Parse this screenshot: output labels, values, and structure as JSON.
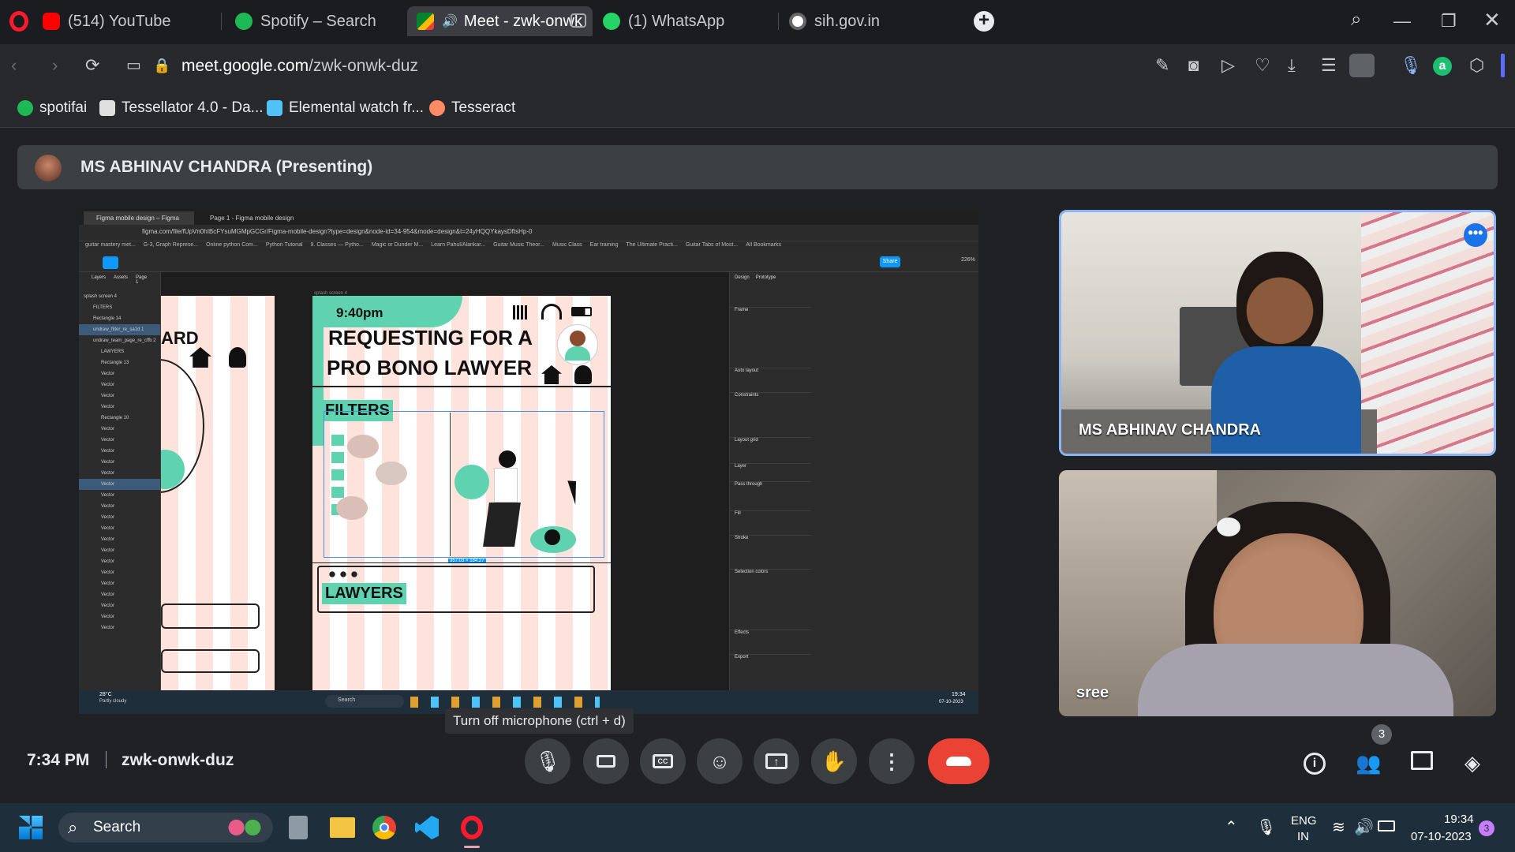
{
  "tabs": [
    {
      "label": "(514) YouTube",
      "icon": "youtube-icon",
      "color": "#ff0000"
    },
    {
      "label": "Spotify – Search",
      "icon": "spotify-icon",
      "color": "#1db954"
    },
    {
      "label": "Meet - zwk-onwk",
      "icon": "meet-icon",
      "color": "#00897b"
    },
    {
      "label": "(1) WhatsApp",
      "icon": "whatsapp-icon",
      "color": "#25d366"
    },
    {
      "label": "sih.gov.in",
      "icon": "globe-icon",
      "color": "#9aa0a6"
    }
  ],
  "address": {
    "host": "meet.google.com",
    "path": "/zwk-onwk-duz"
  },
  "bookmarks": [
    {
      "label": "spotifai",
      "color": "#1db954"
    },
    {
      "label": "Tessellator 4.0 - Da...",
      "color": "#e0e0e0"
    },
    {
      "label": "Elemental watch fr...",
      "color": "#4fc3f7"
    },
    {
      "label": "Tesseract",
      "color": "#ff8a65"
    }
  ],
  "presenter_bar": {
    "text": "MS ABHINAV CHANDRA (Presenting)"
  },
  "shared_screen": {
    "tab1": "Figma mobile design – Figma",
    "tab2": "Page 1 - Figma mobile design",
    "url": "figma.com/file/fUpVn0hIBcFYsuMGMpGCGr/Figma-mobile-design?type=design&node-id=34-954&mode=design&t=24yHQQYkaysDftsHp-0",
    "bookmarks": [
      "guitar mastery met...",
      "G-3, Graph Represe...",
      "Online python Com...",
      "Python Tutorial",
      "9. Classes — Pytho...",
      "Magic or Dunder M...",
      "Learn Pahul/Alankar...",
      "Guitar Music Theor...",
      "Music Class",
      "Ear training",
      "The Ultimate Practi...",
      "Guitar Tabs of Most...",
      "All Bookmarks"
    ],
    "layers_tabs": [
      "Layers",
      "Assets",
      "Page 1"
    ],
    "layers": [
      "splash screen 4",
      "FILTERS",
      "Rectangle 14",
      "undraw_filter_re_sa1d 1",
      "undraw_team_page_re_cffb 2",
      "LAWYERS",
      "Rectangle 13",
      "Vector",
      "Vector",
      "Vector",
      "Vector",
      "Rectangle 10",
      "Vector",
      "Vector",
      "Vector",
      "Vector",
      "Vector",
      "Vector",
      "Vector",
      "Vector",
      "Vector",
      "Vector",
      "Vector",
      "Vector",
      "Vector",
      "Vector",
      "Vector",
      "Vector",
      "Vector",
      "Vector",
      "Vector"
    ],
    "left_frame_text": "ARD",
    "frame_label": "splash screen 4",
    "time": "9:40pm",
    "heading_line1": "REQUESTING FOR A",
    "heading_line2": "PRO BONO  LAWYER",
    "filters": "FILTERS",
    "lawyers": "LAWYERS",
    "dims": "357.03 × 184.27",
    "right_panel_tabs": [
      "Design",
      "Prototype"
    ],
    "right_panel": [
      "Frame",
      "Auto layout",
      "Constraints",
      "Layout grid",
      "Layer",
      "Pass through",
      "Fill",
      "Stroke",
      "Selection colors",
      "Effects",
      "Export"
    ],
    "share": "Share",
    "zoom": "226%",
    "weather": "28°C",
    "weather_sub": "Partly cloudy",
    "search": "Search",
    "clock": "19:34",
    "date": "07-10-2023"
  },
  "participants": [
    {
      "name": "MS ABHINAV CHANDRA"
    },
    {
      "name": "sree"
    }
  ],
  "meeting": {
    "time": "7:34 PM",
    "code": "zwk-onwk-duz",
    "participant_count": "3"
  },
  "tooltip": "Turn off microphone (ctrl + d)",
  "taskbar": {
    "search": "Search",
    "lang1": "ENG",
    "lang2": "IN",
    "clock": "19:34",
    "date": "07-10-2023",
    "notif": "3"
  }
}
